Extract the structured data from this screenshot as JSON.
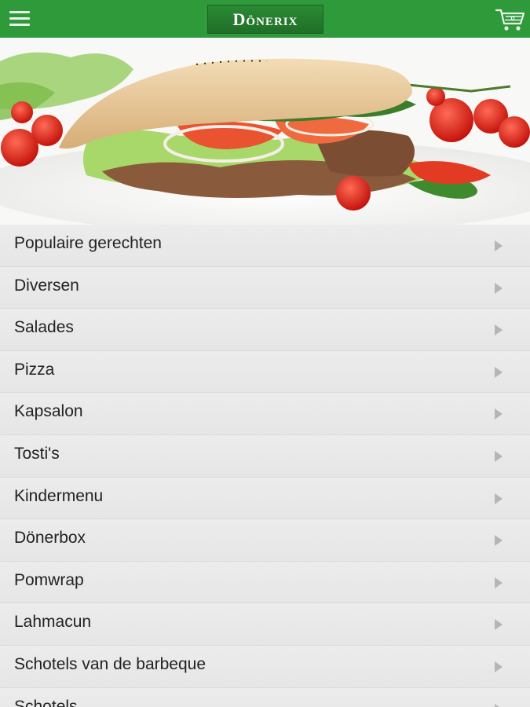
{
  "header": {
    "logo_text": "Dönerix",
    "menu_icon": "hamburger-menu-icon",
    "cart_icon": "shopping-cart-icon",
    "cart_count": "0",
    "colors": {
      "bar": "#2f9a3a",
      "logo_bg": "#1f6f28"
    }
  },
  "categories": [
    {
      "label": "Populaire gerechten"
    },
    {
      "label": "Diversen"
    },
    {
      "label": "Salades"
    },
    {
      "label": "Pizza"
    },
    {
      "label": "Kapsalon"
    },
    {
      "label": "Tosti's"
    },
    {
      "label": "Kindermenu"
    },
    {
      "label": "Dönerbox"
    },
    {
      "label": "Pomwrap"
    },
    {
      "label": "Lahmacun"
    },
    {
      "label": "Schotels van de barbeque"
    },
    {
      "label": "Schotels"
    }
  ]
}
